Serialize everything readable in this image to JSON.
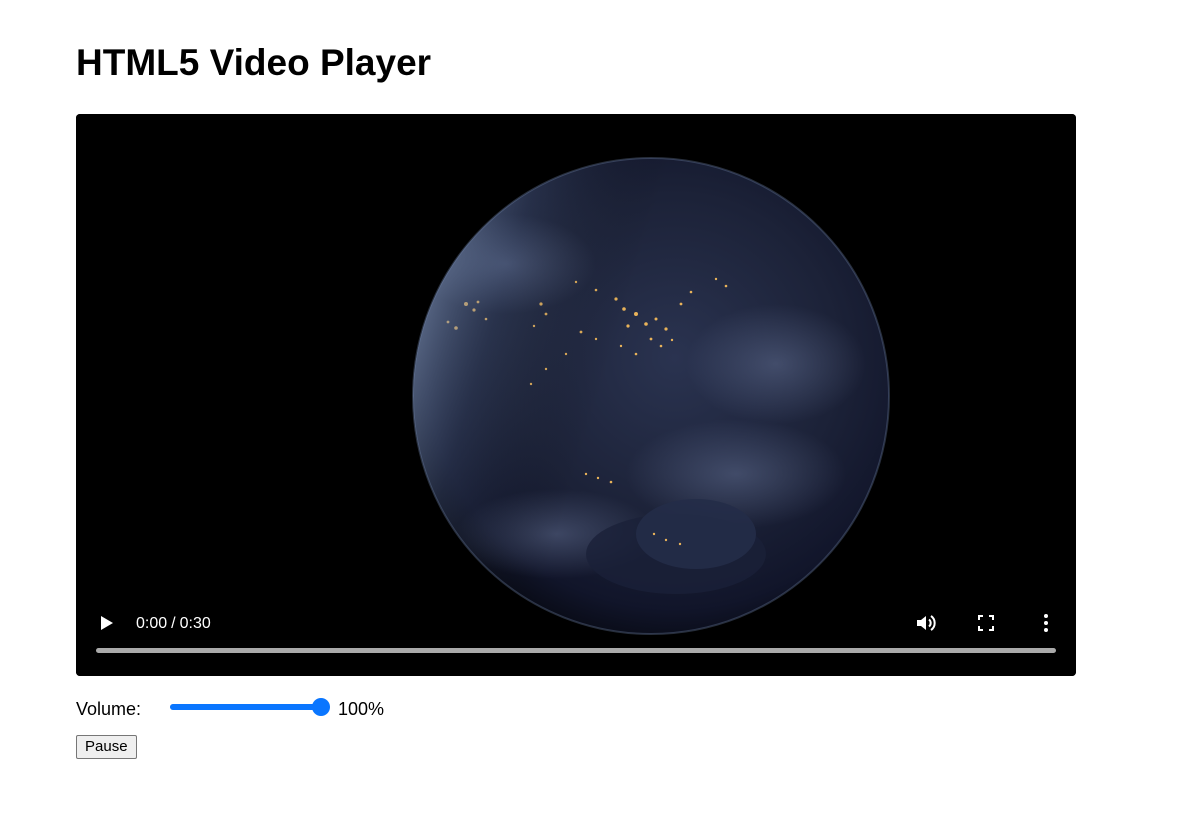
{
  "page": {
    "title": "HTML5 Video Player"
  },
  "player": {
    "current_time": "0:00",
    "separator": "/",
    "duration": "0:30",
    "progress": 0,
    "icons": {
      "play": "play-icon",
      "volume": "volume-up-icon",
      "fullscreen": "fullscreen-icon",
      "more": "more-vertical-icon"
    },
    "colors": {
      "background": "#000000",
      "seek_track": "#c8c8c8",
      "controls_text": "#ffffff"
    }
  },
  "volume": {
    "label": "Volume:",
    "value": 1.0,
    "display": "100%",
    "accent": "#0a76ff"
  },
  "controls": {
    "pause_label": "Pause"
  }
}
